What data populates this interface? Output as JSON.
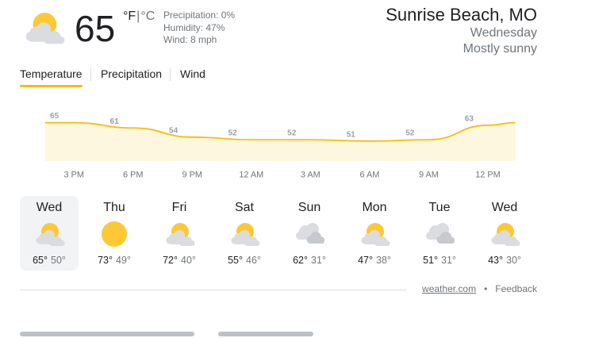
{
  "current": {
    "temp": "65",
    "unit_f": "°F",
    "unit_sep": "|",
    "unit_c": "°C",
    "precipitation": "Precipitation: 0%",
    "humidity": "Humidity: 47%",
    "wind": "Wind: 8 mph",
    "icon": "partly-cloudy-icon"
  },
  "location": {
    "city": "Sunrise Beach, MO",
    "day": "Wednesday",
    "condition": "Mostly sunny"
  },
  "tabs": [
    {
      "label": "Temperature",
      "active": true
    },
    {
      "label": "Precipitation",
      "active": false
    },
    {
      "label": "Wind",
      "active": false
    }
  ],
  "chart_data": {
    "type": "area",
    "times": [
      "3 PM",
      "6 PM",
      "9 PM",
      "12 AM",
      "3 AM",
      "6 AM",
      "9 AM",
      "12 PM"
    ],
    "values": [
      65,
      61,
      54,
      52,
      52,
      51,
      52,
      63
    ],
    "labeled_points": [
      65,
      61,
      54,
      52,
      52,
      51,
      52,
      63
    ],
    "color": "#fbbc04",
    "fill": "#fef7e0",
    "grid": false
  },
  "forecast": [
    {
      "day": "Wed",
      "high": "65°",
      "low": "50°",
      "icon": "partly-cloudy-icon",
      "selected": true
    },
    {
      "day": "Thu",
      "high": "73°",
      "low": "49°",
      "icon": "sunny-icon",
      "selected": false
    },
    {
      "day": "Fri",
      "high": "72°",
      "low": "40°",
      "icon": "partly-cloudy-icon",
      "selected": false
    },
    {
      "day": "Sat",
      "high": "55°",
      "low": "46°",
      "icon": "partly-cloudy-icon",
      "selected": false
    },
    {
      "day": "Sun",
      "high": "62°",
      "low": "31°",
      "icon": "cloudy-icon",
      "selected": false
    },
    {
      "day": "Mon",
      "high": "47°",
      "low": "38°",
      "icon": "partly-cloudy-icon",
      "selected": false
    },
    {
      "day": "Tue",
      "high": "51°",
      "low": "31°",
      "icon": "cloudy-icon",
      "selected": false
    },
    {
      "day": "Wed",
      "high": "43°",
      "low": "30°",
      "icon": "partly-cloudy-icon",
      "selected": false
    }
  ],
  "footer": {
    "source": "weather.com",
    "dot": "•",
    "feedback": "Feedback"
  }
}
